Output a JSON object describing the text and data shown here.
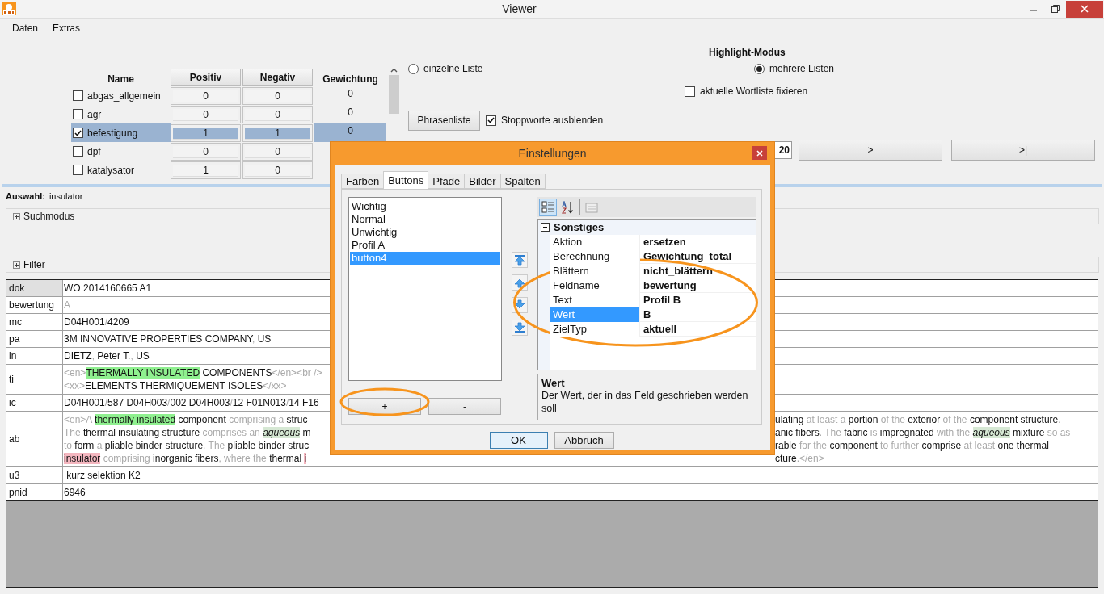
{
  "window": {
    "title": "Viewer"
  },
  "menu": [
    "Daten",
    "Extras"
  ],
  "word_lists": {
    "columns": [
      "Name",
      "Positiv",
      "Negativ",
      "Gewichtung"
    ],
    "rows": [
      {
        "name": "abgas_allgemein",
        "checked": false,
        "selected": false,
        "positiv": "0",
        "negativ": "0",
        "gewichtung": "0"
      },
      {
        "name": "agr",
        "checked": false,
        "selected": false,
        "positiv": "0",
        "negativ": "0",
        "gewichtung": "0"
      },
      {
        "name": "befestigung",
        "checked": true,
        "selected": true,
        "positiv": "1",
        "negativ": "1",
        "gewichtung": "0"
      },
      {
        "name": "dpf",
        "checked": false,
        "selected": false,
        "positiv": "0",
        "negativ": "0"
      },
      {
        "name": "katalysator",
        "checked": false,
        "selected": false,
        "positiv": "1",
        "negativ": "0"
      }
    ]
  },
  "highlight_mode": {
    "title": "Highlight-Modus",
    "options": [
      {
        "label": "einzelne Liste",
        "selected": false
      },
      {
        "label": "mehrere Listen",
        "selected": true
      }
    ]
  },
  "fix_checkbox": {
    "label": "aktuelle Wortliste fixieren",
    "checked": false
  },
  "phrase_button": "Phrasenliste",
  "stopwords_checkbox": {
    "label": "Stoppworte ausblenden",
    "checked": true
  },
  "navigation": {
    "page_field": "20",
    "buttons": [
      ">",
      ">|"
    ]
  },
  "selection": {
    "label": "Auswahl:",
    "value": "insulator"
  },
  "groups": [
    {
      "label": "Suchmodus",
      "expanded": false
    },
    {
      "label": "Filter",
      "expanded": false
    }
  ],
  "record": {
    "rows": [
      {
        "field": "dok",
        "selected": true,
        "lines": [
          {
            "left": [
              {
                "kind": "text",
                "text": "WO 2014160665 A1"
              }
            ]
          }
        ]
      },
      {
        "field": "bewertung",
        "selected": false,
        "lines": [
          {
            "left": [
              {
                "kind": "mute",
                "text": "A"
              }
            ]
          }
        ]
      },
      {
        "field": "mc",
        "selected": false,
        "lines": [
          {
            "left": [
              {
                "kind": "text",
                "text": "D04H001"
              },
              {
                "kind": "mute",
                "text": "/"
              },
              {
                "kind": "text",
                "text": "4209"
              }
            ]
          }
        ]
      },
      {
        "field": "pa",
        "selected": false,
        "lines": [
          {
            "left": [
              {
                "kind": "text",
                "text": "3M INNOVATIVE PROPERTIES COMPANY"
              },
              {
                "kind": "mute",
                "text": ", "
              },
              {
                "kind": "text",
                "text": "US"
              }
            ]
          }
        ]
      },
      {
        "field": "in",
        "selected": false,
        "lines": [
          {
            "left": [
              {
                "kind": "text",
                "text": "DIETZ"
              },
              {
                "kind": "mute",
                "text": ", "
              },
              {
                "kind": "text",
                "text": "Peter T"
              },
              {
                "kind": "mute",
                "text": "., "
              },
              {
                "kind": "text",
                "text": "US"
              }
            ]
          }
        ]
      },
      {
        "field": "ti",
        "selected": false,
        "lines": [
          {
            "left": [
              {
                "kind": "mute",
                "text": "<en>"
              },
              {
                "kind": "hit",
                "text": "THERMALLY INSULATED"
              },
              {
                "kind": "text",
                "text": " COMPONENTS"
              },
              {
                "kind": "mute",
                "text": "</en><br />"
              }
            ]
          },
          {
            "left": [
              {
                "kind": "mute",
                "text": "<xx>"
              },
              {
                "kind": "text",
                "text": "ELEMENTS THERMIQUEMENT ISOLES"
              },
              {
                "kind": "mute",
                "text": "</xx>"
              }
            ]
          }
        ]
      },
      {
        "field": "ic",
        "selected": false,
        "lines": [
          {
            "left": [
              {
                "kind": "text",
                "text": "D04H001"
              },
              {
                "kind": "mute",
                "text": "/"
              },
              {
                "kind": "text",
                "text": "587 D04H003"
              },
              {
                "kind": "mute",
                "text": "/"
              },
              {
                "kind": "text",
                "text": "002 D04H003"
              },
              {
                "kind": "mute",
                "text": "/"
              },
              {
                "kind": "text",
                "text": "12 F01N013"
              },
              {
                "kind": "mute",
                "text": "/"
              },
              {
                "kind": "text",
                "text": "14 F16"
              }
            ]
          }
        ]
      },
      {
        "field": "ab",
        "selected": false,
        "lines": [
          {
            "left": [
              {
                "kind": "mute",
                "text": "<en>A "
              },
              {
                "kind": "hit",
                "text": "thermally insulated"
              },
              {
                "kind": "text",
                "text": " component "
              },
              {
                "kind": "mute",
                "text": "comprising a "
              },
              {
                "kind": "text",
                "text": "struc"
              }
            ],
            "right": [
              {
                "kind": "text",
                "text": "ulating"
              },
              {
                "kind": "mute",
                "text": " at least a "
              },
              {
                "kind": "text",
                "text": "portion"
              },
              {
                "kind": "mute",
                "text": " of the "
              },
              {
                "kind": "text",
                "text": "exterior"
              },
              {
                "kind": "mute",
                "text": " of the "
              },
              {
                "kind": "text",
                "text": "component structure"
              },
              {
                "kind": "mute",
                "text": "."
              }
            ]
          },
          {
            "left": [
              {
                "kind": "mute",
                "text": "The "
              },
              {
                "kind": "text",
                "text": "thermal insulating structure"
              },
              {
                "kind": "mute",
                "text": " comprises an "
              },
              {
                "kind": "italic",
                "text": "aqueous"
              },
              {
                "kind": "text",
                "text": " m"
              }
            ],
            "right": [
              {
                "kind": "text",
                "text": "anic fibers"
              },
              {
                "kind": "mute",
                "text": ". The "
              },
              {
                "kind": "text",
                "text": "fabric"
              },
              {
                "kind": "mute",
                "text": " is "
              },
              {
                "kind": "text",
                "text": "impregnated"
              },
              {
                "kind": "mute",
                "text": " with the "
              },
              {
                "kind": "italic",
                "text": "aqueous"
              },
              {
                "kind": "text",
                "text": " mixture"
              },
              {
                "kind": "mute",
                "text": " so as"
              }
            ]
          },
          {
            "left": [
              {
                "kind": "mute",
                "text": "to "
              },
              {
                "kind": "text",
                "text": "form"
              },
              {
                "kind": "mute",
                "text": " a "
              },
              {
                "kind": "text",
                "text": "pliable binder structure"
              },
              {
                "kind": "mute",
                "text": ". The "
              },
              {
                "kind": "text",
                "text": "pliable binder struc"
              }
            ],
            "right": [
              {
                "kind": "text",
                "text": "rable"
              },
              {
                "kind": "mute",
                "text": " for the "
              },
              {
                "kind": "text",
                "text": "component"
              },
              {
                "kind": "mute",
                "text": " to further "
              },
              {
                "kind": "text",
                "text": "comprise"
              },
              {
                "kind": "mute",
                "text": " at least "
              },
              {
                "kind": "text",
                "text": "one thermal"
              }
            ]
          },
          {
            "left": [
              {
                "kind": "bad",
                "text": "insulator"
              },
              {
                "kind": "mute",
                "text": " comprising "
              },
              {
                "kind": "text",
                "text": "inorganic fibers"
              },
              {
                "kind": "mute",
                "text": ", where the "
              },
              {
                "kind": "text",
                "text": "thermal "
              },
              {
                "kind": "bad",
                "text": "i"
              }
            ],
            "right": [
              {
                "kind": "text",
                "text": "cture"
              },
              {
                "kind": "mute",
                "text": ".</en>"
              }
            ]
          }
        ]
      },
      {
        "field": "u3",
        "selected": false,
        "lines": [
          {
            "left": [
              {
                "kind": "text",
                "text": " kurz selektion K2"
              }
            ]
          }
        ]
      },
      {
        "field": "pnid",
        "selected": false,
        "lines": [
          {
            "left": [
              {
                "kind": "text",
                "text": "6946"
              }
            ]
          }
        ]
      }
    ]
  },
  "dialog": {
    "title": "Einstellungen",
    "tabs": [
      {
        "label": "Farben",
        "selected": false
      },
      {
        "label": "Buttons",
        "selected": true
      },
      {
        "label": "Pfade",
        "selected": false
      },
      {
        "label": "Bilder",
        "selected": false
      },
      {
        "label": "Spalten",
        "selected": false
      }
    ],
    "button_list": [
      {
        "label": "Wichtig",
        "selected": false
      },
      {
        "label": "Normal",
        "selected": false
      },
      {
        "label": "Unwichtig",
        "selected": false
      },
      {
        "label": "Profil A",
        "selected": false
      },
      {
        "label": "button4",
        "selected": true
      }
    ],
    "list_buttons": [
      "+",
      "-"
    ],
    "categorized": true,
    "properties": {
      "category": "Sonstiges",
      "expanded": true,
      "items": [
        {
          "name": "Aktion",
          "value": "ersetzen",
          "selected": false
        },
        {
          "name": "Berechnung",
          "value": "Gewichtung_total",
          "selected": false
        },
        {
          "name": "Blättern",
          "value": "nicht_blättern",
          "selected": false
        },
        {
          "name": "Feldname",
          "value": "bewertung",
          "selected": false
        },
        {
          "name": "Text",
          "value": "Profil B",
          "selected": false
        },
        {
          "name": "Wert",
          "value": "B",
          "selected": true
        },
        {
          "name": "ZielTyp",
          "value": "aktuell",
          "selected": false
        }
      ]
    },
    "description": {
      "title": "Wert",
      "text": "Der Wert, der in das Feld geschrieben werden soll"
    },
    "buttons": [
      "OK",
      "Abbruch"
    ]
  }
}
